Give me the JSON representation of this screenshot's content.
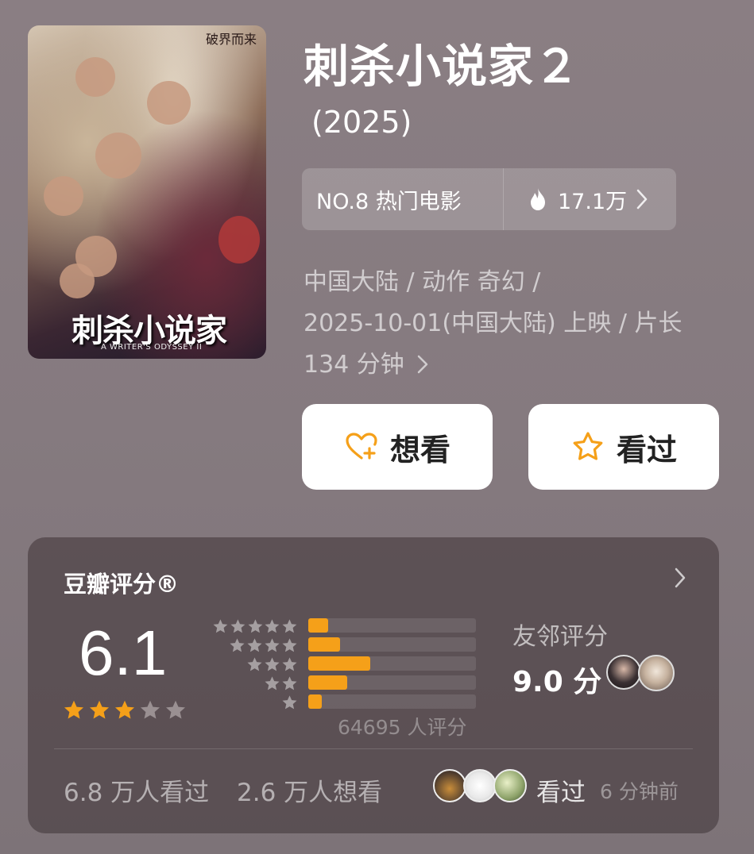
{
  "movie": {
    "title": "刺杀小说家２",
    "year": "(2025)",
    "poster": {
      "tagline": "破界而来",
      "title_text": "刺杀小说家",
      "subtitle_text": "A WRITER'S ODYSSEY II"
    },
    "rank": {
      "label": "NO.8 热门电影",
      "heat": "17.1万"
    },
    "meta_lines": [
      "中国大陆 / 动作 奇幻 /",
      "2025-10-01(中国大陆) 上映 / 片长",
      "134 分钟"
    ]
  },
  "actions": {
    "want_label": "想看",
    "seen_label": "看过"
  },
  "rating": {
    "title": "豆瓣评分®",
    "score": "6.1",
    "stars": 3,
    "distribution": [
      {
        "stars": 5,
        "fraction": 0.12
      },
      {
        "stars": 4,
        "fraction": 0.19
      },
      {
        "stars": 3,
        "fraction": 0.37
      },
      {
        "stars": 2,
        "fraction": 0.23
      },
      {
        "stars": 1,
        "fraction": 0.08
      }
    ],
    "count": "64695 人评分",
    "friend_label": "友邻评分",
    "friend_score": "9.0 分",
    "seen_count": "6.8 万人看过",
    "want_count": "2.6 万人想看",
    "friends_seen": "看过",
    "friends_seen_time": "6 分钟前"
  },
  "colors": {
    "accent": "#f5a019",
    "star_empty": "#9a9092"
  },
  "icons": {
    "heart": "heart-plus-icon",
    "star": "star-outline-icon",
    "flame": "flame-icon",
    "chevron": "chevron-right-icon"
  }
}
